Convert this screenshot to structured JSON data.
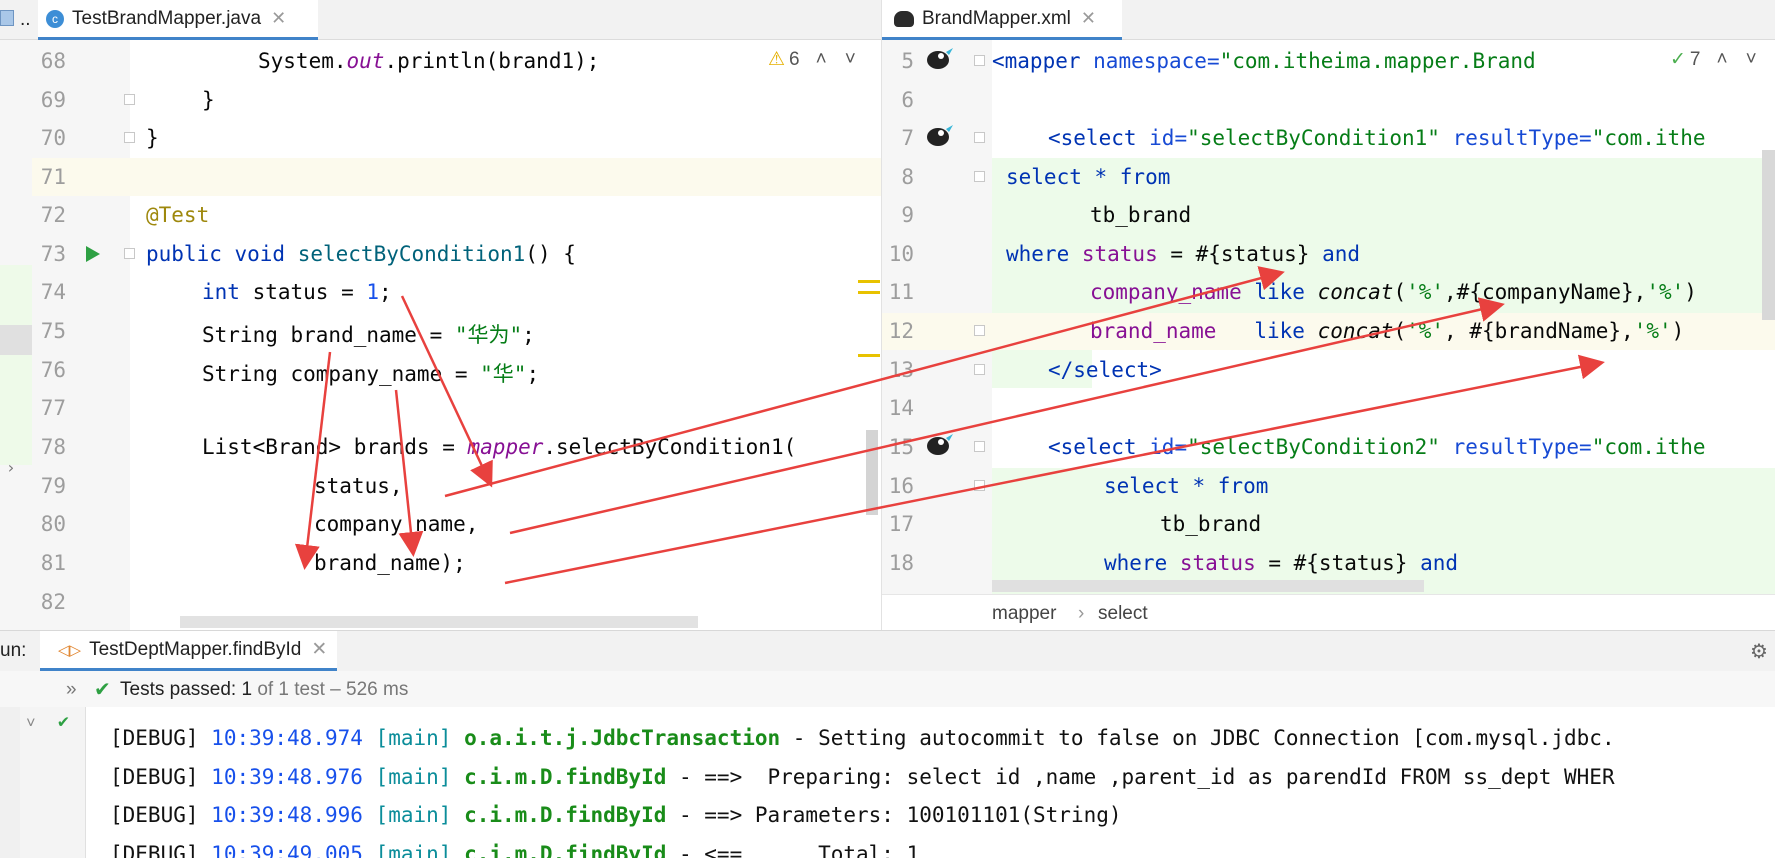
{
  "left_editor": {
    "tab_prev": "..",
    "tab_title": "TestBrandMapper.java",
    "warning_count": "6",
    "lines": {
      "n68": "68",
      "n69": "69",
      "n70": "70",
      "n71": "71",
      "n72": "72",
      "n73": "73",
      "n74": "74",
      "n75": "75",
      "n76": "76",
      "n77": "77",
      "n78": "78",
      "n79": "79",
      "n80": "80",
      "n81": "81",
      "n82": "82"
    },
    "code": {
      "l68_a": "System.",
      "l68_b": "out",
      "l68_c": ".println(brand1);",
      "l69": "}",
      "l70": "}",
      "l72": "@Test",
      "l73_kw": "public void ",
      "l73_m": "selectByCondition1",
      "l73_end": "() {",
      "l74_kw": "int ",
      "l74_a": "status = ",
      "l74_n": "1",
      "l74_end": ";",
      "l75_a": "String brand_name = ",
      "l75_s": "\"华为\"",
      "l75_end": ";",
      "l76_a": "String company_name = ",
      "l76_s": "\"华\"",
      "l76_end": ";",
      "l78_a": "List<Brand> brands = ",
      "l78_f": "mapper",
      "l78_b": ".selectByCondition1(",
      "l79": "status,",
      "l80": "company_name,",
      "l81": "brand_name);"
    }
  },
  "right_editor": {
    "tab_title": "BrandMapper.xml",
    "check_count": "7",
    "lines": {
      "n5": "5",
      "n6": "6",
      "n7": "7",
      "n8": "8",
      "n9": "9",
      "n10": "10",
      "n11": "11",
      "n12": "12",
      "n13": "13",
      "n14": "14",
      "n15": "15",
      "n16": "16",
      "n17": "17",
      "n18": "18"
    },
    "code": {
      "l5_t": "<mapper ",
      "l5_a": "namespace=",
      "l5_v": "\"com.itheima.mapper.BrandMappe",
      "l7_t": "<select ",
      "l7_a": "id=",
      "l7_v": "\"selectByCondition1\" ",
      "l7_a2": "resultType=",
      "l7_v2": "\"com.ithe",
      "l8_kw": "select * from",
      "l9": "tb_brand",
      "l10_kw": "where ",
      "l10_f": "status",
      "l10_m": " = #{status} ",
      "l10_and": "and",
      "l11_f": "company_name",
      "l11_kw": " like ",
      "l11_c": "concat",
      "l11_a": "(",
      "l11_s1": "'%'",
      "l11_b": ",#{companyName},",
      "l11_s2": "'%'",
      "l11_end": ")",
      "l12_f": "brand_name",
      "l12_kw": "   like ",
      "l12_c": "concat",
      "l12_a": "(",
      "l12_s1": "'%'",
      "l12_b": ", #{brandName},",
      "l12_s2": "'%'",
      "l12_end": ")",
      "l13": "</select>",
      "l15_t": "<select ",
      "l15_a": "id=",
      "l15_v": "\"selectByCondition2\" ",
      "l15_a2": "resultType=",
      "l15_v2": "\"com.ithe",
      "l16_kw": "select * from",
      "l17": "tb_brand",
      "l18_kw": "where ",
      "l18_f": "status",
      "l18_m": " = #{status} ",
      "l18_and": "and"
    },
    "breadcrumb": {
      "item1": "mapper",
      "sep": "›",
      "item2": "select"
    }
  },
  "run_panel": {
    "label": "un:",
    "tab_title": "TestDeptMapper.findById",
    "tests_passed": "Tests passed:",
    "passed_count": "1",
    "of_text": "of 1 test – 526 ms",
    "logs": [
      {
        "level": "[DEBUG]",
        "time": "10:39:48.974",
        "thread": "[main]",
        "cls": "o.a.i.t.j.JdbcTransaction",
        "msg": " - Setting autocommit to false on JDBC Connection [com.mysql.jdbc."
      },
      {
        "level": "[DEBUG]",
        "time": "10:39:48.976",
        "thread": "[main]",
        "cls": "c.i.m.D.findById",
        "msg": " - ==>  Preparing: select id ,name ,parent_id as parendId FROM ss_dept WHER"
      },
      {
        "level": "[DEBUG]",
        "time": "10:39:48.996",
        "thread": "[main]",
        "cls": "c.i.m.D.findById",
        "msg": " - ==> Parameters: 100101101(String)"
      },
      {
        "level": "[DEBUG]",
        "time": "10:39:49.005",
        "thread": "[main]",
        "cls": "c.i.m.D.findById",
        "msg": " - <==      Total: 1"
      }
    ]
  },
  "colors": {
    "keyword": "#0033b3",
    "string": "#067d17",
    "number": "#1750eb",
    "arrow": "#e8413e",
    "green_bg": "#edfbea",
    "current_line": "#fcfaed"
  }
}
